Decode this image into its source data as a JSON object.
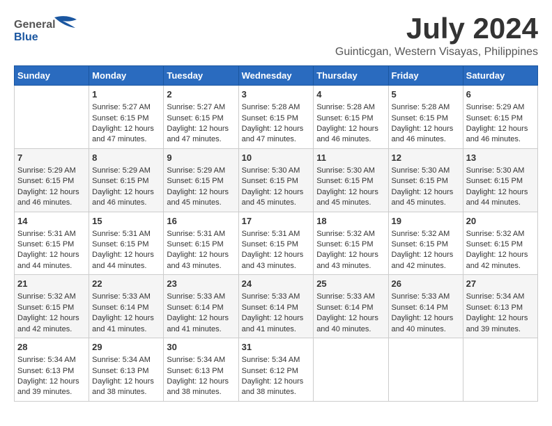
{
  "header": {
    "logo_general": "General",
    "logo_blue": "Blue",
    "month_title": "July 2024",
    "location": "Guinticgan, Western Visayas, Philippines"
  },
  "weekdays": [
    "Sunday",
    "Monday",
    "Tuesday",
    "Wednesday",
    "Thursday",
    "Friday",
    "Saturday"
  ],
  "weeks": [
    [
      {
        "day": "",
        "content": ""
      },
      {
        "day": "1",
        "content": "Sunrise: 5:27 AM\nSunset: 6:15 PM\nDaylight: 12 hours\nand 47 minutes."
      },
      {
        "day": "2",
        "content": "Sunrise: 5:27 AM\nSunset: 6:15 PM\nDaylight: 12 hours\nand 47 minutes."
      },
      {
        "day": "3",
        "content": "Sunrise: 5:28 AM\nSunset: 6:15 PM\nDaylight: 12 hours\nand 47 minutes."
      },
      {
        "day": "4",
        "content": "Sunrise: 5:28 AM\nSunset: 6:15 PM\nDaylight: 12 hours\nand 46 minutes."
      },
      {
        "day": "5",
        "content": "Sunrise: 5:28 AM\nSunset: 6:15 PM\nDaylight: 12 hours\nand 46 minutes."
      },
      {
        "day": "6",
        "content": "Sunrise: 5:29 AM\nSunset: 6:15 PM\nDaylight: 12 hours\nand 46 minutes."
      }
    ],
    [
      {
        "day": "7",
        "content": "Sunrise: 5:29 AM\nSunset: 6:15 PM\nDaylight: 12 hours\nand 46 minutes."
      },
      {
        "day": "8",
        "content": "Sunrise: 5:29 AM\nSunset: 6:15 PM\nDaylight: 12 hours\nand 46 minutes."
      },
      {
        "day": "9",
        "content": "Sunrise: 5:29 AM\nSunset: 6:15 PM\nDaylight: 12 hours\nand 45 minutes."
      },
      {
        "day": "10",
        "content": "Sunrise: 5:30 AM\nSunset: 6:15 PM\nDaylight: 12 hours\nand 45 minutes."
      },
      {
        "day": "11",
        "content": "Sunrise: 5:30 AM\nSunset: 6:15 PM\nDaylight: 12 hours\nand 45 minutes."
      },
      {
        "day": "12",
        "content": "Sunrise: 5:30 AM\nSunset: 6:15 PM\nDaylight: 12 hours\nand 45 minutes."
      },
      {
        "day": "13",
        "content": "Sunrise: 5:30 AM\nSunset: 6:15 PM\nDaylight: 12 hours\nand 44 minutes."
      }
    ],
    [
      {
        "day": "14",
        "content": "Sunrise: 5:31 AM\nSunset: 6:15 PM\nDaylight: 12 hours\nand 44 minutes."
      },
      {
        "day": "15",
        "content": "Sunrise: 5:31 AM\nSunset: 6:15 PM\nDaylight: 12 hours\nand 44 minutes."
      },
      {
        "day": "16",
        "content": "Sunrise: 5:31 AM\nSunset: 6:15 PM\nDaylight: 12 hours\nand 43 minutes."
      },
      {
        "day": "17",
        "content": "Sunrise: 5:31 AM\nSunset: 6:15 PM\nDaylight: 12 hours\nand 43 minutes."
      },
      {
        "day": "18",
        "content": "Sunrise: 5:32 AM\nSunset: 6:15 PM\nDaylight: 12 hours\nand 43 minutes."
      },
      {
        "day": "19",
        "content": "Sunrise: 5:32 AM\nSunset: 6:15 PM\nDaylight: 12 hours\nand 42 minutes."
      },
      {
        "day": "20",
        "content": "Sunrise: 5:32 AM\nSunset: 6:15 PM\nDaylight: 12 hours\nand 42 minutes."
      }
    ],
    [
      {
        "day": "21",
        "content": "Sunrise: 5:32 AM\nSunset: 6:15 PM\nDaylight: 12 hours\nand 42 minutes."
      },
      {
        "day": "22",
        "content": "Sunrise: 5:33 AM\nSunset: 6:14 PM\nDaylight: 12 hours\nand 41 minutes."
      },
      {
        "day": "23",
        "content": "Sunrise: 5:33 AM\nSunset: 6:14 PM\nDaylight: 12 hours\nand 41 minutes."
      },
      {
        "day": "24",
        "content": "Sunrise: 5:33 AM\nSunset: 6:14 PM\nDaylight: 12 hours\nand 41 minutes."
      },
      {
        "day": "25",
        "content": "Sunrise: 5:33 AM\nSunset: 6:14 PM\nDaylight: 12 hours\nand 40 minutes."
      },
      {
        "day": "26",
        "content": "Sunrise: 5:33 AM\nSunset: 6:14 PM\nDaylight: 12 hours\nand 40 minutes."
      },
      {
        "day": "27",
        "content": "Sunrise: 5:34 AM\nSunset: 6:13 PM\nDaylight: 12 hours\nand 39 minutes."
      }
    ],
    [
      {
        "day": "28",
        "content": "Sunrise: 5:34 AM\nSunset: 6:13 PM\nDaylight: 12 hours\nand 39 minutes."
      },
      {
        "day": "29",
        "content": "Sunrise: 5:34 AM\nSunset: 6:13 PM\nDaylight: 12 hours\nand 38 minutes."
      },
      {
        "day": "30",
        "content": "Sunrise: 5:34 AM\nSunset: 6:13 PM\nDaylight: 12 hours\nand 38 minutes."
      },
      {
        "day": "31",
        "content": "Sunrise: 5:34 AM\nSunset: 6:12 PM\nDaylight: 12 hours\nand 38 minutes."
      },
      {
        "day": "",
        "content": ""
      },
      {
        "day": "",
        "content": ""
      },
      {
        "day": "",
        "content": ""
      }
    ]
  ]
}
